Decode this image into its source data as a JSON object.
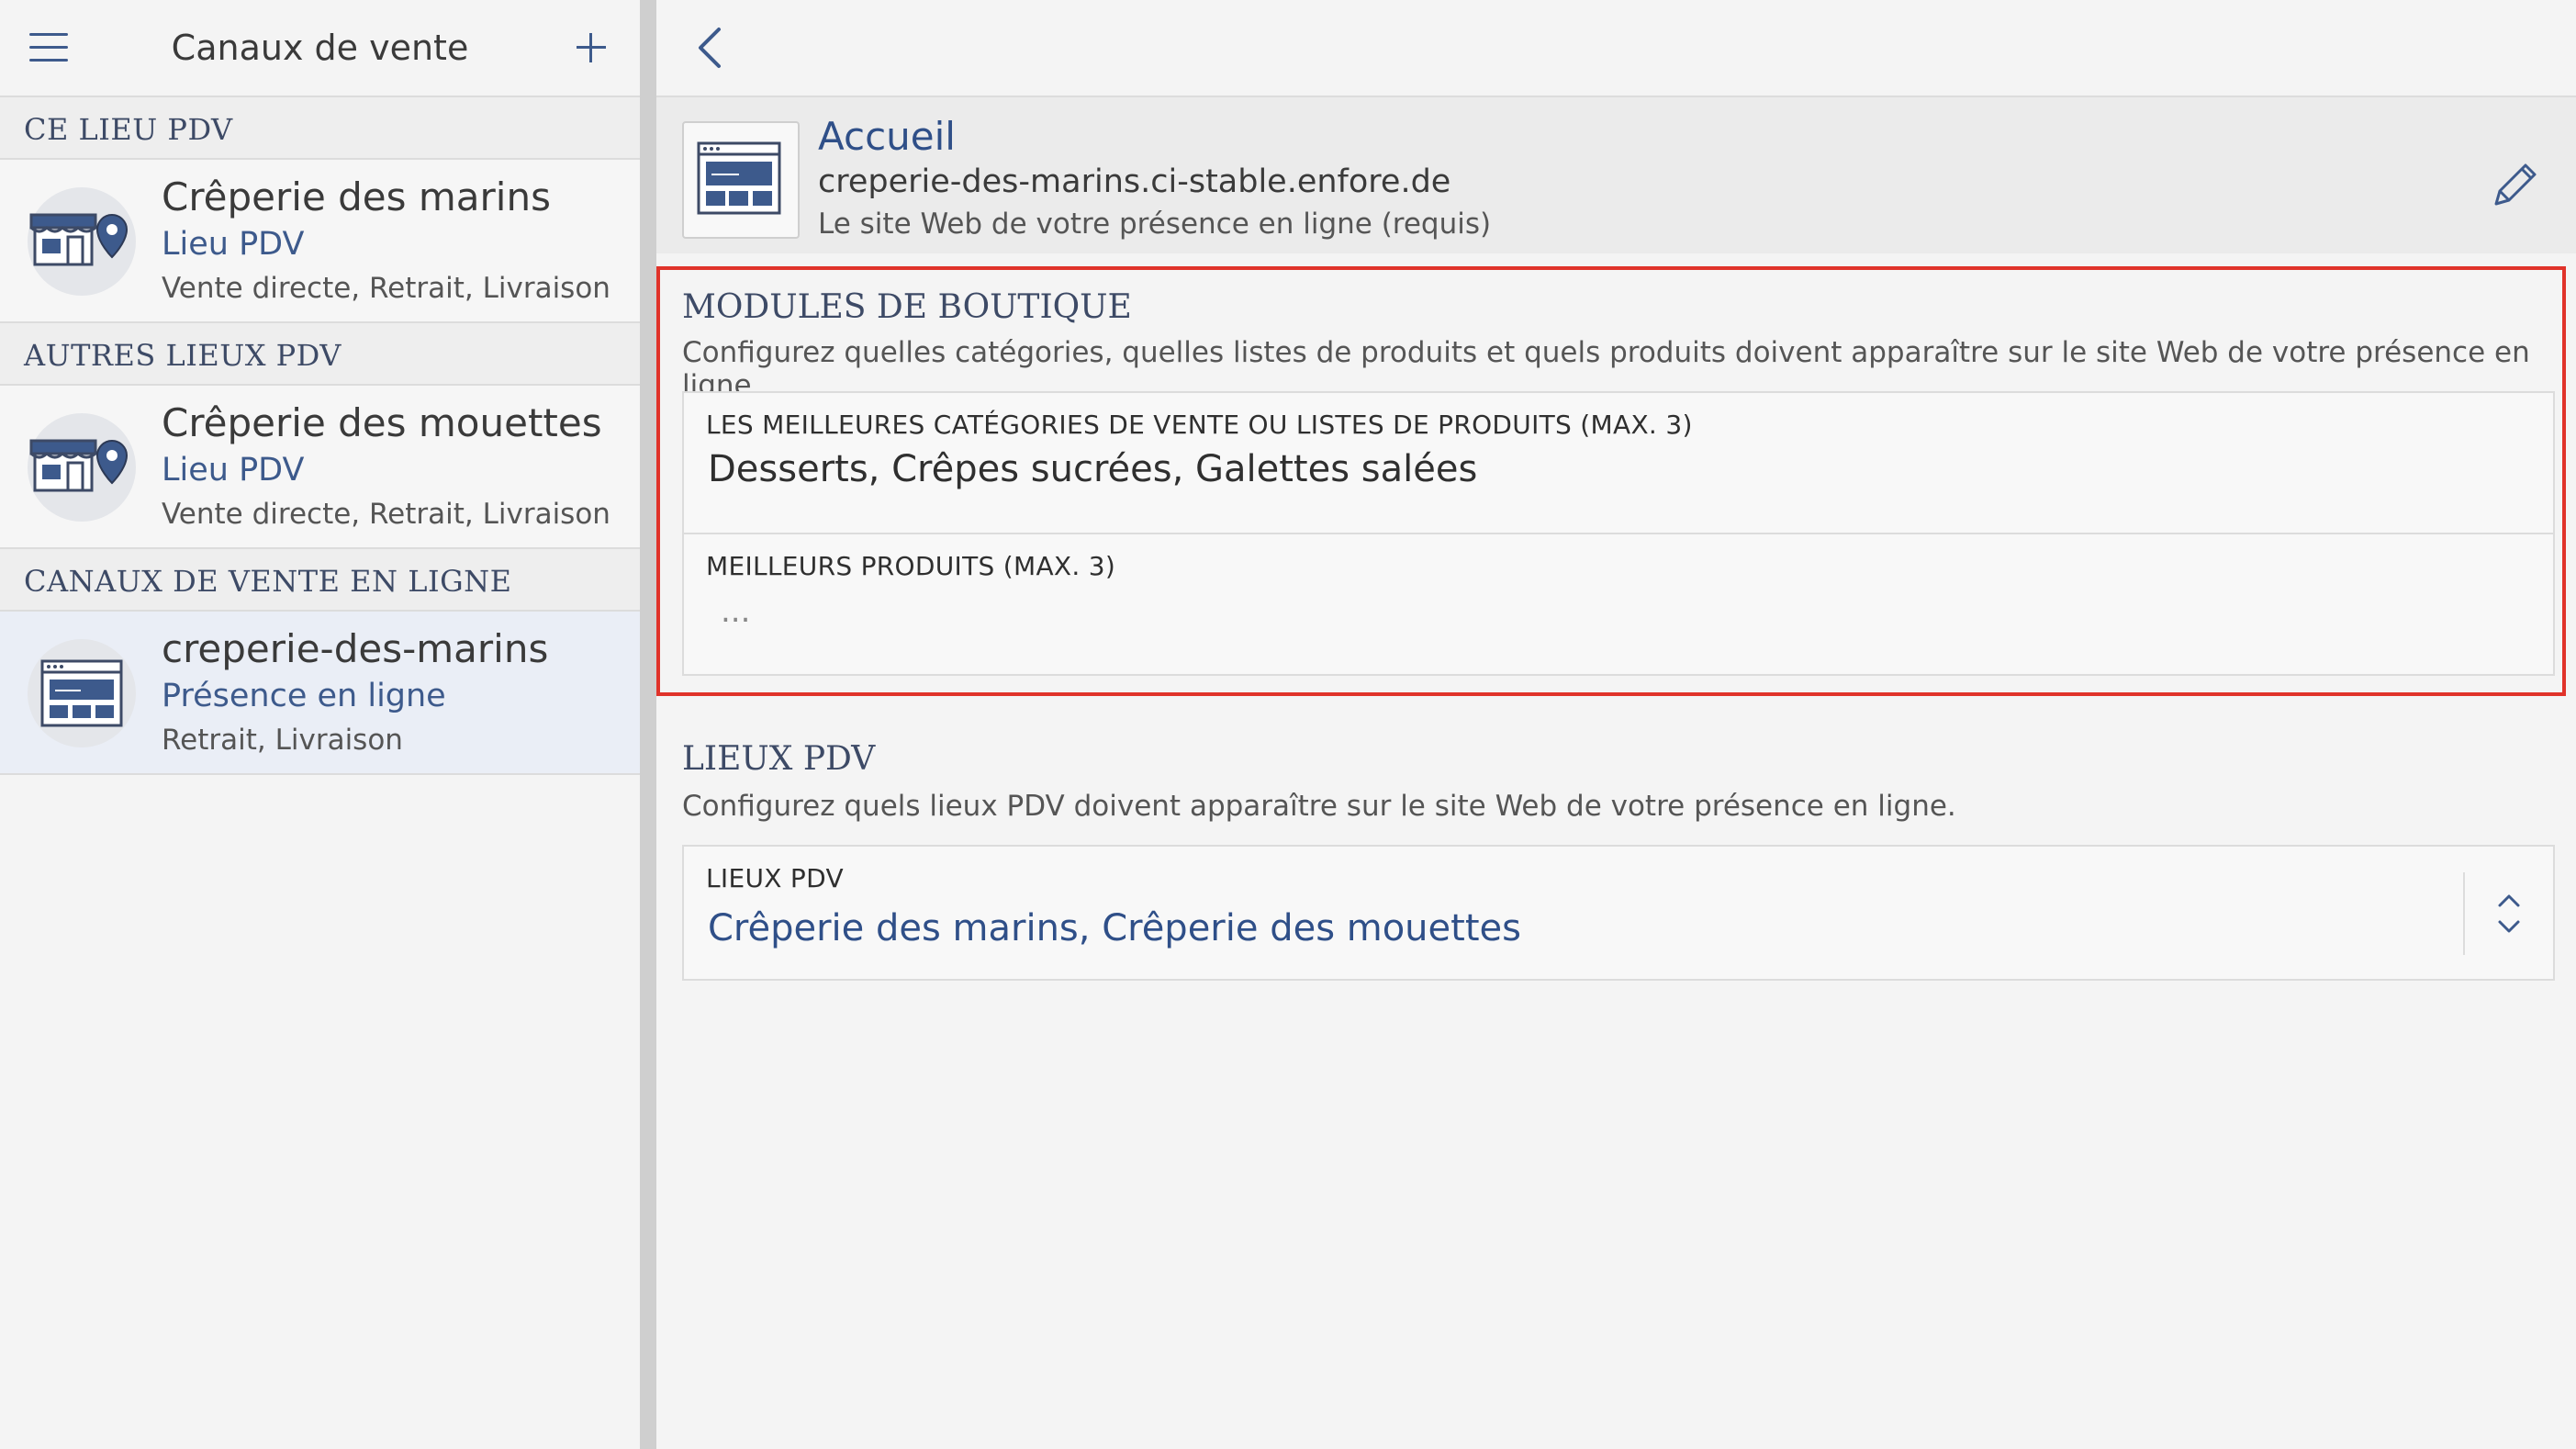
{
  "sidebar": {
    "title": "Canaux de vente",
    "sections": {
      "this_location": "CE LIEU PDV",
      "other_locations": "AUTRES LIEUX PDV",
      "online_channels": "CANAUX DE VENTE EN LIGNE"
    },
    "channels": [
      {
        "name": "Crêperie des marins",
        "type": "Lieu PDV",
        "modes": "Vente directe, Retrait, Livraison",
        "icon": "store-location-icon"
      },
      {
        "name": "Crêperie des mouettes",
        "type": "Lieu PDV",
        "modes": "Vente directe, Retrait, Livraison",
        "icon": "store-location-icon"
      },
      {
        "name": "creperie-des-marins",
        "type": "Présence en ligne",
        "modes": "Retrait, Livraison",
        "icon": "website-icon"
      }
    ]
  },
  "detail": {
    "home": {
      "title": "Accueil",
      "url": "creperie-des-marins.ci-stable.enfore.de",
      "description": "Le site Web de votre présence en ligne (requis)"
    },
    "modules": {
      "title": "MODULES DE BOUTIQUE",
      "description": "Configurez quelles catégories, quelles listes de produits et quels produits doivent apparaître sur le site Web de votre présence en ligne",
      "top_categories": {
        "label": "LES MEILLEURES CATÉGORIES DE VENTE OU LISTES DE PRODUITS (MAX. 3)",
        "value": "Desserts, Crêpes sucrées, Galettes salées"
      },
      "top_products": {
        "label": "MEILLEURS PRODUITS (MAX. 3)",
        "value": "..."
      }
    },
    "locations": {
      "title": "LIEUX PDV",
      "description": "Configurez quels lieux PDV doivent apparaître sur le site Web de votre présence en ligne.",
      "field_label": "LIEUX PDV",
      "value": "Crêperie des marins, Crêperie des mouettes"
    }
  },
  "colors": {
    "accent": "#3d5a8c",
    "highlight_border": "#e0332a",
    "selected_bg": "#eaeef6"
  }
}
